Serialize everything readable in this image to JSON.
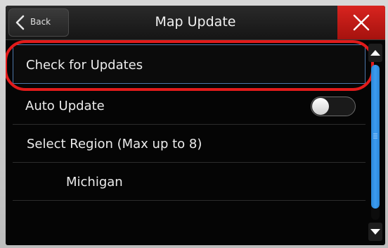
{
  "header": {
    "back_label": "Back",
    "title": "Map Update",
    "close_icon": "close-icon",
    "close_color": "#c81c17"
  },
  "list": {
    "items": [
      {
        "label": "Check for Updates"
      },
      {
        "label": "Auto Update",
        "toggle_on": false
      },
      {
        "label": "Select Region (Max up to 8)"
      },
      {
        "label": "Michigan"
      }
    ]
  },
  "scrollbar": {
    "up_icon": "triangle-up-icon",
    "down_icon": "triangle-down-icon",
    "thumb_color": "#2f8fe3"
  },
  "annotation": {
    "highlight_color": "#e21b1b"
  }
}
